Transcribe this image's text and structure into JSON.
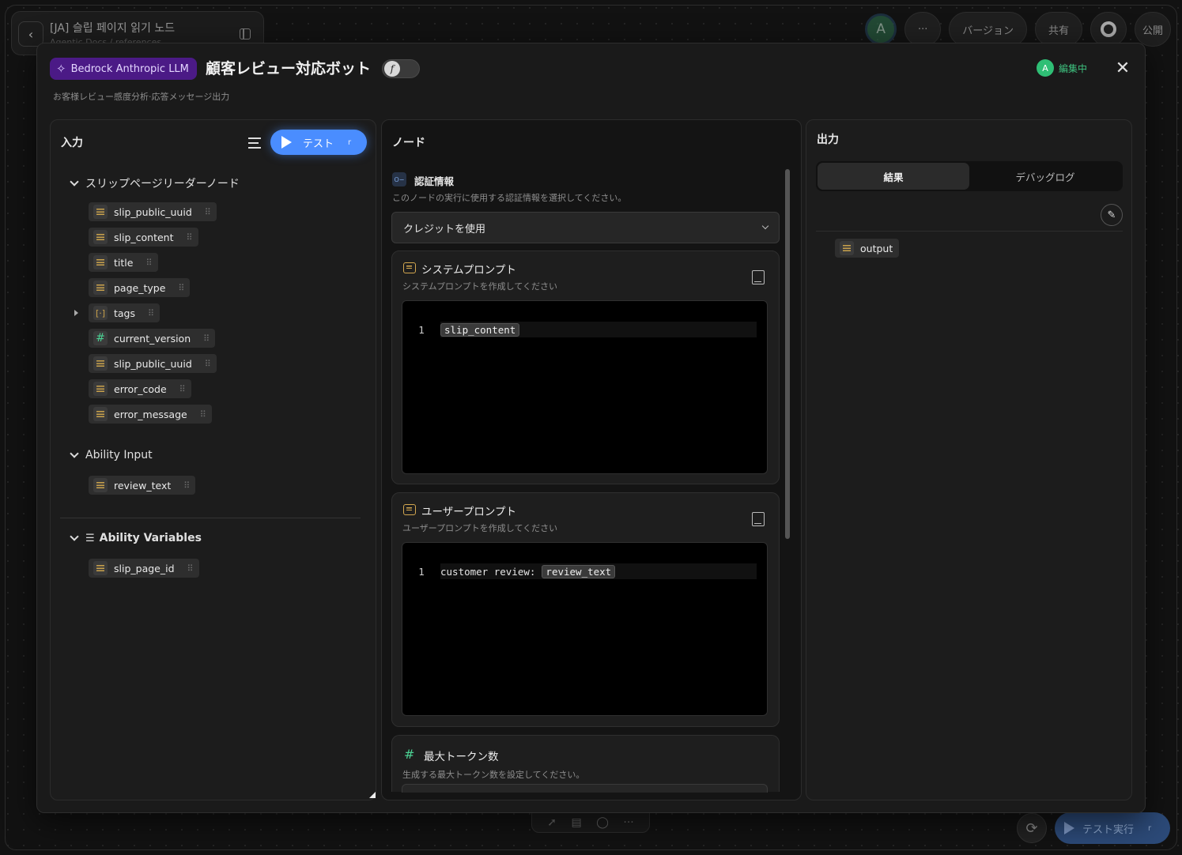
{
  "workspace": {
    "title": "[JA] 슬립 페이지 읽기 노드",
    "subtitle": "Agentic Docs / references"
  },
  "topbar": {
    "avatar_initial": "A",
    "more_label": "···",
    "version_label": "バージョン",
    "share_label": "共有",
    "publish_label": "公開"
  },
  "modal": {
    "node_type": "Bedrock Anthropic LLM",
    "title": "顧客レビュー対応ボット",
    "fx_label": "f",
    "description": "お客様レビュー感度分析·応答メッセージ出力",
    "editing_avatar": "A",
    "editing_label": "編集中",
    "close_label": "✕"
  },
  "input_panel": {
    "heading": "入力",
    "test_button": "テスト",
    "test_shortcut": "r",
    "groups": [
      {
        "name": "スリップページリーダーノード",
        "items": [
          {
            "label": "slip_public_uuid",
            "type": "text"
          },
          {
            "label": "slip_content",
            "type": "text"
          },
          {
            "label": "title",
            "type": "text"
          },
          {
            "label": "page_type",
            "type": "text"
          },
          {
            "label": "tags",
            "type": "array"
          },
          {
            "label": "current_version",
            "type": "number"
          },
          {
            "label": "slip_public_uuid",
            "type": "text"
          },
          {
            "label": "error_code",
            "type": "text"
          },
          {
            "label": "error_message",
            "type": "text"
          }
        ]
      },
      {
        "name": "Ability Input",
        "items": [
          {
            "label": "review_text",
            "type": "text"
          }
        ]
      },
      {
        "name": "Ability Variables",
        "items": [
          {
            "label": "slip_page_id",
            "type": "text"
          }
        ]
      }
    ]
  },
  "node_panel": {
    "heading": "ノード",
    "credentials": {
      "label": "認証情報",
      "description": "このノードの実行に使用する認証情報を選択してください。",
      "selected": "クレジットを使用"
    },
    "system_prompt": {
      "title": "システムプロンプト",
      "description": "システムプロンプトを作成してください",
      "line_number": "1",
      "token": "slip_content"
    },
    "user_prompt": {
      "title": "ユーザープロンプト",
      "description": "ユーザープロンプトを作成してください",
      "line_number": "1",
      "text": "customer review:",
      "token": "review_text"
    },
    "max_tokens": {
      "title": "最大トークン数",
      "description": "生成する最大トークン数を設定してください。"
    }
  },
  "output_panel": {
    "heading": "出力",
    "tabs": [
      "結果",
      "デバッグログ"
    ],
    "active_tab": 0,
    "output_item": "output"
  },
  "footer": {
    "run_test_label": "テスト実行",
    "run_shortcut": "r"
  }
}
